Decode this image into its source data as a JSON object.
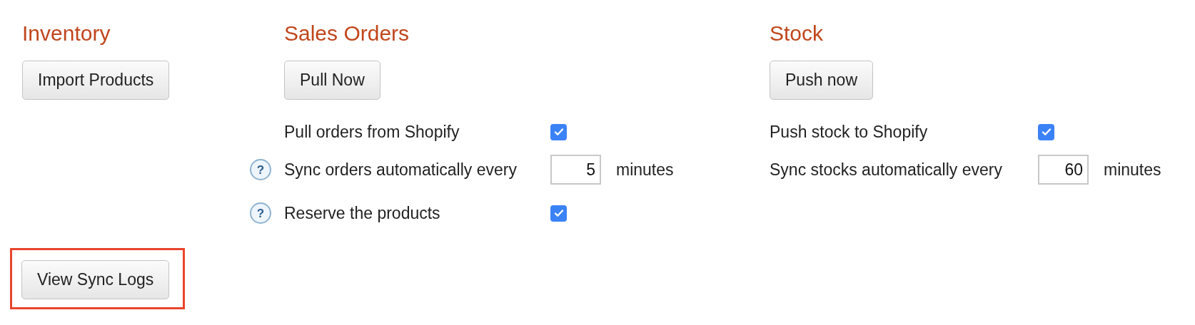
{
  "sections": [
    {
      "title": "Inventory",
      "button": "Import Products"
    },
    {
      "title": "Sales Orders",
      "button": "Pull Now",
      "options": [
        {
          "kind": "checkbox",
          "label": "Pull orders from Shopify",
          "checked": true
        },
        {
          "kind": "number",
          "label": "Sync orders automatically every",
          "help": "?",
          "value": "5",
          "unit": "minutes"
        },
        {
          "kind": "checkbox",
          "label": "Reserve the products",
          "help": "?",
          "checked": true
        }
      ]
    },
    {
      "title": "Stock",
      "button": "Push now",
      "options": [
        {
          "kind": "checkbox",
          "label": "Push stock to Shopify",
          "checked": true
        },
        {
          "kind": "number",
          "label": "Sync stocks automatically every",
          "value": "60",
          "unit": "minutes"
        }
      ]
    }
  ],
  "logs_button": {
    "label": "View Sync Logs",
    "highlighted": true
  }
}
